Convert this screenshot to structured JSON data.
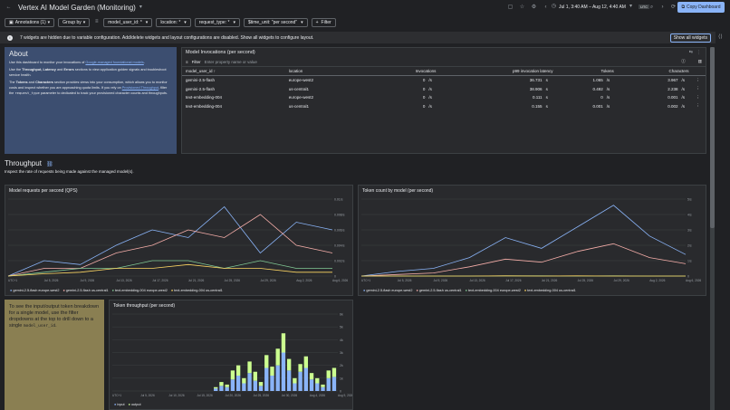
{
  "header": {
    "title": "Vertex AI Model Garden (Monitoring)",
    "date_range": "Jul 1, 3:40 AM – Aug 12, 4:40 AM",
    "utc_badge": "UTC",
    "copy_label": "Copy Dashboard"
  },
  "filters": {
    "annotations": "Annotations (1)",
    "group_by": "Group by",
    "model_user_id": "model_user_id: *",
    "location": "location: *",
    "request_type": "request_type: *",
    "time_unit": "$time_unit: \"per second\"",
    "filter": "Filter"
  },
  "banner": {
    "text": "7 widgets are hidden due to variable configuration. Add/delete widgets and layout configurations are disabled. Show all widgets to configure layout.",
    "button": "Show all widgets"
  },
  "about": {
    "title": "About",
    "p1_pre": "Use this dashboard to monitor your invocations of ",
    "p1_link": "Google-managed foundational models",
    "p1_post": ".",
    "p2_pre": "Use the ",
    "p2_bold": "Throughput, Latency",
    "p2_mid": " and ",
    "p2_bold2": "Errors",
    "p2_post": " sections to view application golden signals and troubleshoot service health.",
    "p3_pre": "The ",
    "p3_bold": "Tokens",
    "p3_and": " and ",
    "p3_bold2": "Characters",
    "p3_mid": " section provides views into your consumption, which allows you to monitor costs and inspect whether you are approaching quota limits. If you rely on ",
    "p3_link": "Provisioned Throughput",
    "p3_mid2": ", filter the ",
    "p3_code": "request_type",
    "p3_post": " parameter to dedicated to track your provisioned character counts and throughputs."
  },
  "invocations": {
    "title": "Model Invocations (per second)",
    "filter_label": "Filter",
    "filter_placeholder": "Enter property name or value",
    "columns": [
      "model_user_id",
      "location",
      "Invocations",
      "p99 invocation latency",
      "Tokens",
      "Characters"
    ],
    "rows": [
      {
        "model": "gemini-2.5-flash",
        "location": "europe-west2",
        "inv": "0",
        "inv_u": "/s",
        "lat": "36.731",
        "lat_u": "s",
        "tok": "1.065",
        "tok_u": "/s",
        "chr": "3.967",
        "chr_u": "/s"
      },
      {
        "model": "gemini-2.5-flash",
        "location": "us-central1",
        "inv": "0",
        "inv_u": "/s",
        "lat": "38.906",
        "lat_u": "s",
        "tok": "0.492",
        "tok_u": "/s",
        "chr": "2.238",
        "chr_u": "/s"
      },
      {
        "model": "text-embedding-004",
        "location": "europe-west2",
        "inv": "0",
        "inv_u": "/s",
        "lat": "0.111",
        "lat_u": "s",
        "tok": "0",
        "tok_u": "/s",
        "chr": "0.001",
        "chr_u": "/s"
      },
      {
        "model": "text-embedding-004",
        "location": "us-central1",
        "inv": "0",
        "inv_u": "/s",
        "lat": "0.155",
        "lat_u": "s",
        "tok": "0.001",
        "tok_u": "/s",
        "chr": "0.002",
        "chr_u": "/s"
      }
    ]
  },
  "throughput": {
    "title": "Throughput",
    "subtitle": "Inspect the rate of requests being made against the managed model(s)."
  },
  "tip": {
    "pre": "To see the input/output token breakdown for a single model, use the filter dropdowns at the top to drill down to a single ",
    "code": "model_user_id",
    "post": "."
  },
  "colors": {
    "s1": "#8ab4f8",
    "s2": "#f6aea9",
    "s3": "#81c995",
    "s4": "#fdd663",
    "input": "#8ab4f8",
    "output": "#ccff90"
  },
  "chart_data": [
    {
      "type": "line",
      "title": "Model requests per second (QPS)",
      "yticks": [
        "0.01/s",
        "0.008/s",
        "0.006/s",
        "0.004/s",
        "0.002/s",
        "0"
      ],
      "xticks": [
        "UTC+1",
        "Jul 5, 2026",
        "Jul 9, 2026",
        "Jul 13, 2026",
        "Jul 17, 2026",
        "Jul 21, 2026",
        "Jul 25, 2026",
        "Jul 29, 2026",
        "Aug 2, 2026",
        "Aug 6, 2026"
      ],
      "ylim": [
        0,
        0.01
      ],
      "series": [
        {
          "name": "gemini-2.5-flash europe-west2",
          "values": [
            0,
            0.002,
            0.0015,
            0.004,
            0.006,
            0.005,
            0.009,
            0.003,
            0.007,
            0.006
          ]
        },
        {
          "name": "gemini-2.5-flash us-central1",
          "values": [
            0,
            0.001,
            0.001,
            0.003,
            0.004,
            0.006,
            0.005,
            0.008,
            0.004,
            0.003
          ]
        },
        {
          "name": "text-embedding-004 europe-west2",
          "values": [
            0,
            0.0005,
            0.001,
            0.001,
            0.002,
            0.002,
            0.001,
            0.002,
            0.001,
            0.001
          ]
        },
        {
          "name": "text-embedding-004 us-central1",
          "values": [
            0,
            0.0003,
            0.0005,
            0.001,
            0.001,
            0.0015,
            0.001,
            0.001,
            0.0005,
            0.0005
          ]
        }
      ]
    },
    {
      "type": "line",
      "title": "Token count by model (per second)",
      "yticks": [
        "5/s",
        "4/s",
        "3/s",
        "2/s",
        "1/s",
        "0"
      ],
      "xticks": [
        "UTC+1",
        "Jul 5, 2026",
        "Jul 9, 2026",
        "Jul 13, 2026",
        "Jul 17, 2026",
        "Jul 21, 2026",
        "Jul 25, 2026",
        "Jul 29, 2026",
        "Aug 2, 2026",
        "Aug 6, 2026"
      ],
      "ylim": [
        0,
        5
      ],
      "series": [
        {
          "name": "gemini-2.5-flash europe-west2",
          "values": [
            0,
            0.3,
            0.5,
            1.2,
            2.5,
            1.8,
            3.2,
            4.6,
            2.6,
            1.4
          ]
        },
        {
          "name": "gemini-2.5-flash us-central1",
          "values": [
            0,
            0.1,
            0.2,
            0.6,
            1.1,
            0.9,
            1.6,
            2.1,
            1.2,
            0.8
          ]
        },
        {
          "name": "text-embedding-004 europe-west2",
          "values": [
            0,
            0,
            0,
            0,
            0.01,
            0.01,
            0,
            0.01,
            0,
            0
          ]
        },
        {
          "name": "text-embedding-004 us-central1",
          "values": [
            0,
            0,
            0,
            0,
            0.01,
            0,
            0.01,
            0,
            0,
            0
          ]
        }
      ]
    },
    {
      "type": "bar",
      "title": "Token throughput (per second)",
      "yticks": [
        "6k",
        "5k",
        "4k",
        "3k",
        "2k",
        "1k",
        "0"
      ],
      "xticks": [
        "UTC+1",
        "Jul 5, 2026",
        "Jul 10, 2026",
        "Jul 15, 2026",
        "Jul 20, 2026",
        "Jul 25, 2026",
        "Jul 30, 2026",
        "Aug 4, 2026",
        "Aug 9, 2026"
      ],
      "ylim": [
        0,
        6000
      ],
      "series": [
        {
          "name": "input",
          "values": [
            0,
            0,
            0,
            0,
            0,
            0,
            0,
            0,
            0,
            0,
            0,
            0,
            0,
            0,
            0,
            0,
            0,
            0,
            200,
            400,
            300,
            900,
            1200,
            600,
            1400,
            800,
            400,
            1800,
            1200,
            2000,
            3000,
            1600,
            600,
            1500,
            1800,
            900,
            600,
            300,
            1000,
            1100
          ]
        },
        {
          "name": "output",
          "values": [
            0,
            0,
            0,
            0,
            0,
            0,
            0,
            0,
            0,
            0,
            0,
            0,
            0,
            0,
            0,
            0,
            0,
            0,
            100,
            300,
            200,
            700,
            800,
            400,
            900,
            700,
            300,
            1000,
            700,
            1300,
            1500,
            900,
            400,
            600,
            900,
            500,
            400,
            200,
            600,
            700
          ]
        }
      ]
    }
  ]
}
